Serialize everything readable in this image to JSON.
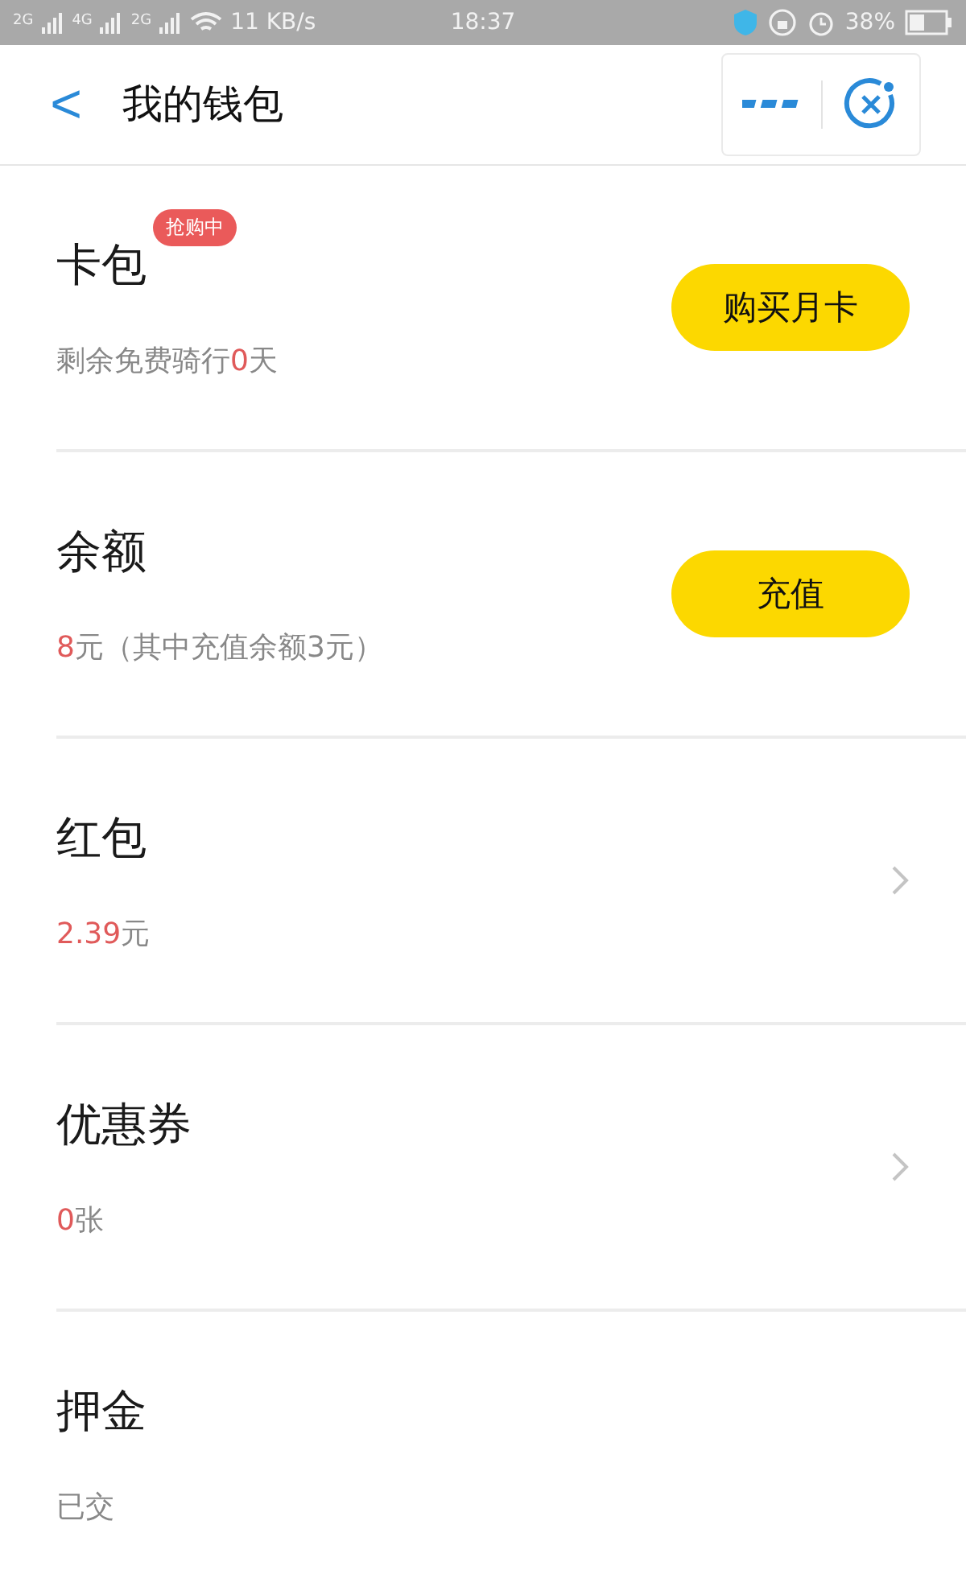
{
  "status_bar": {
    "networks": [
      "2G",
      "4G",
      "2G"
    ],
    "speed": "11 KB/s",
    "time": "18:37",
    "battery": "38%"
  },
  "header": {
    "back": "<",
    "title": "我的钱包"
  },
  "rows": [
    {
      "kind": "button",
      "title": "卡包",
      "badge": "抢购中",
      "subtitle": [
        {
          "text": "剩余免费骑行",
          "highlight": false
        },
        {
          "text": "0",
          "highlight": true
        },
        {
          "text": "天",
          "highlight": false
        }
      ],
      "action": "购买月卡"
    },
    {
      "kind": "button",
      "title": "余额",
      "subtitle": [
        {
          "text": "8",
          "highlight": true
        },
        {
          "text": "元（其中充值余额3元）",
          "highlight": false
        }
      ],
      "action": "充值"
    },
    {
      "kind": "chevron",
      "title": "红包",
      "subtitle": [
        {
          "text": "2.39",
          "highlight": true
        },
        {
          "text": "元",
          "highlight": false
        }
      ]
    },
    {
      "kind": "chevron",
      "title": "优惠券",
      "subtitle": [
        {
          "text": "0",
          "highlight": true
        },
        {
          "text": "张",
          "highlight": false
        }
      ]
    },
    {
      "kind": "plain",
      "title": "押金",
      "subtitle": [
        {
          "text": "已交",
          "highlight": false
        }
      ]
    }
  ]
}
